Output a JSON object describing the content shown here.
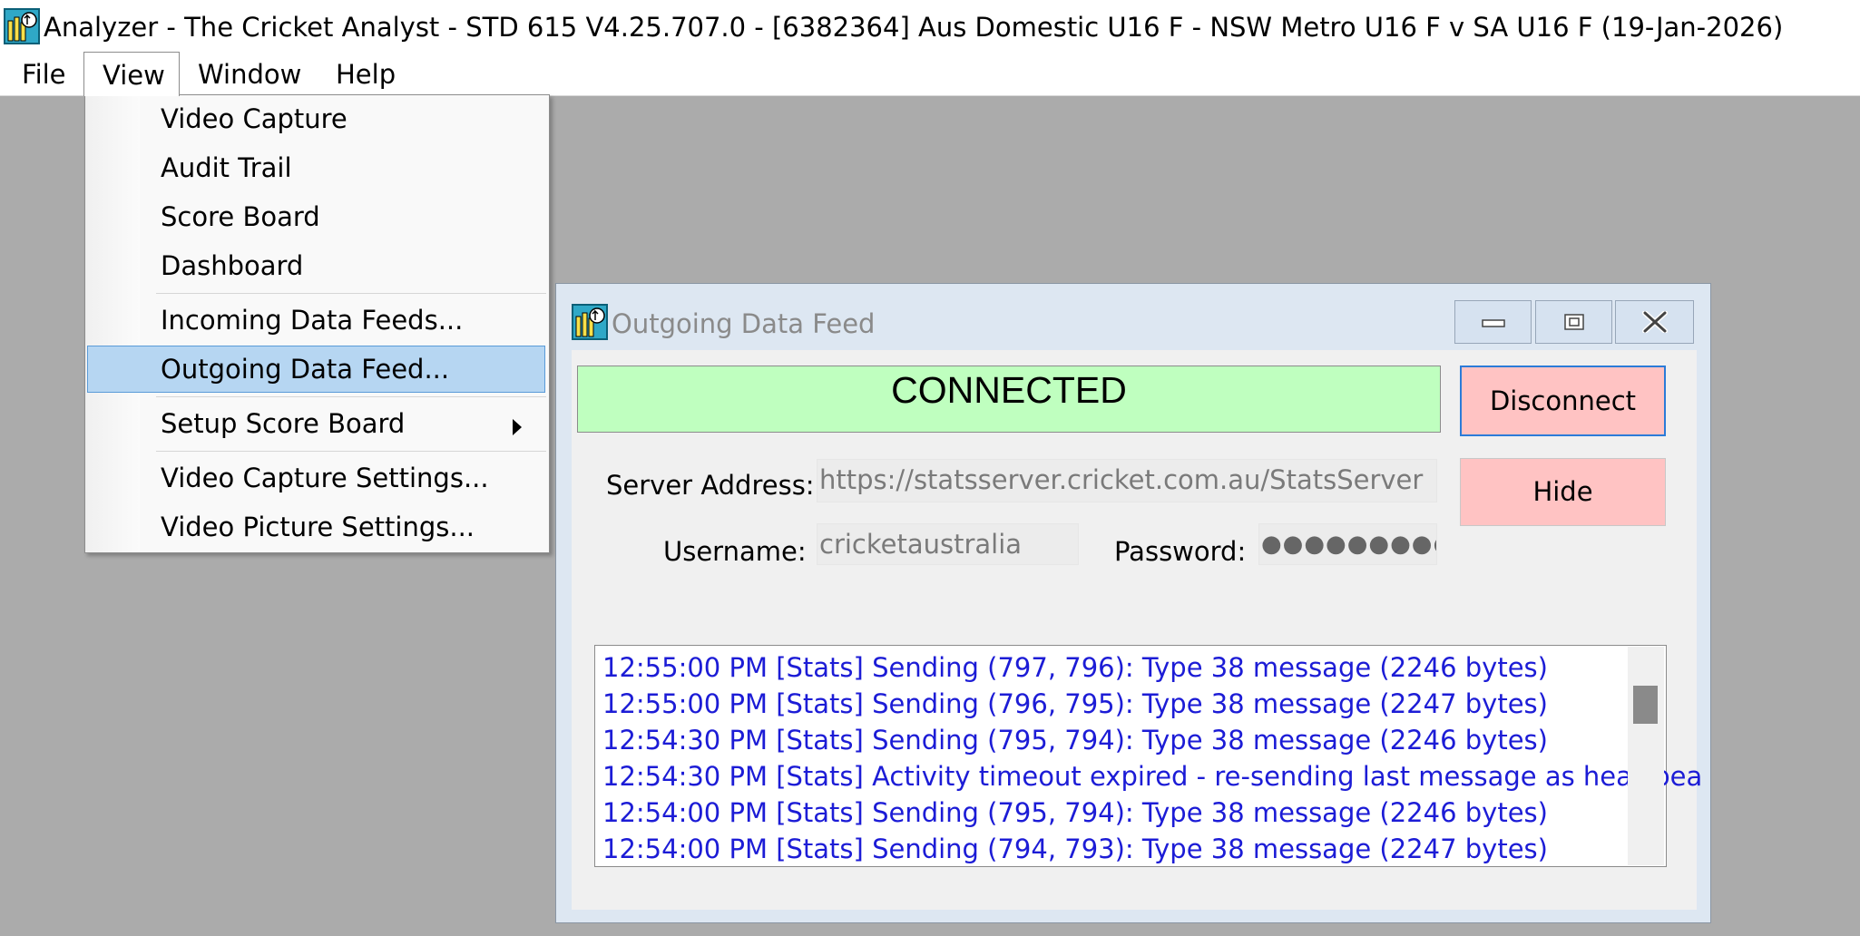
{
  "window": {
    "title": "Analyzer - The Cricket Analyst - STD 615 V4.25.707.0 - [6382364] Aus Domestic U16 F - NSW Metro U16 F v SA U16 F (19-Jan-2026)",
    "icon": "cricket-analyst-app-icon"
  },
  "menubar": {
    "items": [
      {
        "label": "File"
      },
      {
        "label": "View"
      },
      {
        "label": "Window"
      },
      {
        "label": "Help"
      }
    ],
    "open_menu": "View"
  },
  "view_menu": {
    "items": [
      {
        "label": "Video Capture"
      },
      {
        "label": "Audit Trail"
      },
      {
        "label": "Score Board"
      },
      {
        "label": "Dashboard"
      },
      {
        "label": "Incoming Data Feeds..."
      },
      {
        "label": "Outgoing Data Feed...",
        "highlighted": true
      },
      {
        "label": "Setup Score Board",
        "submenu_icon": "triangle-right-icon"
      },
      {
        "label": "Video Capture Settings..."
      },
      {
        "label": "Video Picture Settings..."
      }
    ]
  },
  "dialog": {
    "title": "Outgoing Data Feed",
    "icon": "cricket-analyst-app-icon",
    "window_buttons": [
      "minimize-icon",
      "restore-icon",
      "close-icon"
    ],
    "status": {
      "text": "CONNECTED",
      "color": "#bfffbf"
    },
    "buttons": {
      "disconnect": "Disconnect",
      "hide": "Hide",
      "color": "#ffc3c3"
    },
    "server_label": "Server Address:",
    "server_value": "https://statsserver.cricket.com.au/StatsServer",
    "username_label": "Username:",
    "username_value": "cricketaustralia",
    "password_label": "Password:",
    "password_value": "●●●●●●●●●●",
    "log": {
      "color": "#1c1cd6",
      "lines": [
        "12:55:00 PM [Stats] Sending (797, 796): Type 38 message (2246 bytes)",
        "12:55:00 PM [Stats] Sending (796, 795): Type 38 message (2247 bytes)",
        "12:54:30 PM [Stats] Sending (795, 794): Type 38 message (2246 bytes)",
        "12:54:30 PM [Stats] Activity timeout expired - re-sending last message as heartbea",
        "12:54:00 PM [Stats] Sending (795, 794): Type 38 message (2246 bytes)",
        "12:54:00 PM [Stats] Sending (794, 793): Type 38 message (2247 bytes)"
      ]
    }
  }
}
